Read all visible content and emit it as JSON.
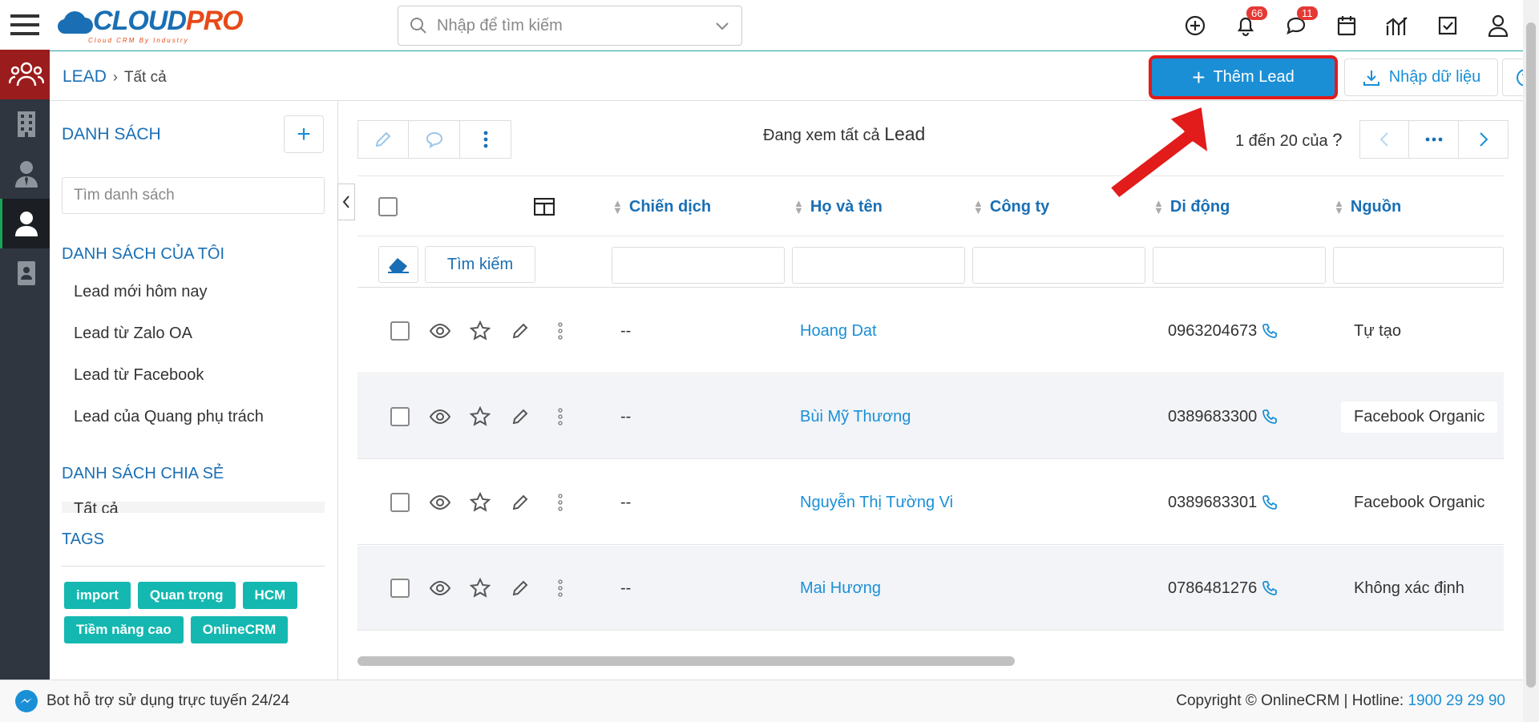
{
  "app": {
    "logo_main": "CLOUD",
    "logo_accent": "PRO",
    "logo_sub": "Cloud CRM By Industry"
  },
  "search": {
    "placeholder": "Nhập để tìm kiếm"
  },
  "header": {
    "notifications_count": "66",
    "messages_count": "11"
  },
  "breadcrumb": {
    "module": "LEAD",
    "current": "Tất cả"
  },
  "actions": {
    "add_label": "Thêm Lead",
    "import_label": "Nhập dữ liệu"
  },
  "sidebar": {
    "title": "DANH SÁCH",
    "search_placeholder": "Tìm danh sách",
    "my_lists_title": "DANH SÁCH CỦA TÔI",
    "my_lists": [
      "Lead mới hôm nay",
      "Lead từ Zalo OA",
      "Lead từ Facebook",
      "Lead của Quang phụ trách"
    ],
    "shared_title": "DANH SÁCH CHIA SẺ",
    "shared_partial": "Tất cả",
    "tags_title": "TAGS",
    "tags": [
      "import",
      "Quan trọng",
      "HCM",
      "Tiềm năng cao",
      "OnlineCRM"
    ]
  },
  "main": {
    "viewing_prefix": "Đang xem tất cả",
    "viewing_module": "Lead",
    "pager_text": "1 đến 20 của",
    "pager_unknown": "?",
    "columns": [
      "Chiến dịch",
      "Họ và tên",
      "Công ty",
      "Di động",
      "Nguồn"
    ],
    "search_button": "Tìm kiếm",
    "rows": [
      {
        "campaign": "--",
        "name": "Hoang Dat",
        "company": "",
        "mobile": "0963204673",
        "source": "Tự tạo"
      },
      {
        "campaign": "--",
        "name": "Bùi Mỹ Thương",
        "company": "",
        "mobile": "0389683300",
        "source": "Facebook Organic"
      },
      {
        "campaign": "--",
        "name": "Nguyễn Thị Tường Vi",
        "company": "",
        "mobile": "0389683301",
        "source": "Facebook Organic"
      },
      {
        "campaign": "--",
        "name": "Mai Hương",
        "company": "",
        "mobile": "0786481276",
        "source": "Không xác định"
      }
    ]
  },
  "footer": {
    "bot_text": "Bot hỗ trợ sử dụng trực tuyến 24/24",
    "copyright": "Copyright © OnlineCRM | Hotline: ",
    "hotline": "1900 29 29 90"
  },
  "colors": {
    "primary": "#1a8fd6",
    "link": "#1a6fb4",
    "tag": "#14b8b0",
    "highlight": "#e21b1b",
    "rail": "#2f3640"
  }
}
